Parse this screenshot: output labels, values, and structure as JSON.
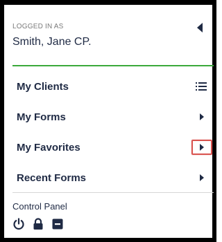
{
  "header": {
    "logged_in_label": "LOGGED IN AS",
    "user_name": "Smith, Jane CP.",
    "collapse_icon": "caret-left-icon"
  },
  "menu": {
    "items": [
      {
        "label": "My Clients",
        "icon": "list-icon"
      },
      {
        "label": "My Forms",
        "icon": "caret-right-icon"
      },
      {
        "label": "My Favorites",
        "icon": "caret-right-icon",
        "highlighted": true
      },
      {
        "label": "Recent Forms",
        "icon": "caret-right-icon"
      }
    ]
  },
  "control_panel": {
    "title": "Control Panel",
    "icons": [
      "power-icon",
      "lock-icon",
      "minus-square-icon"
    ]
  },
  "colors": {
    "accent_green": "#3aa93a",
    "text_dark": "#1f2a44",
    "highlight_red": "#d9534f",
    "frame": "#000000"
  }
}
